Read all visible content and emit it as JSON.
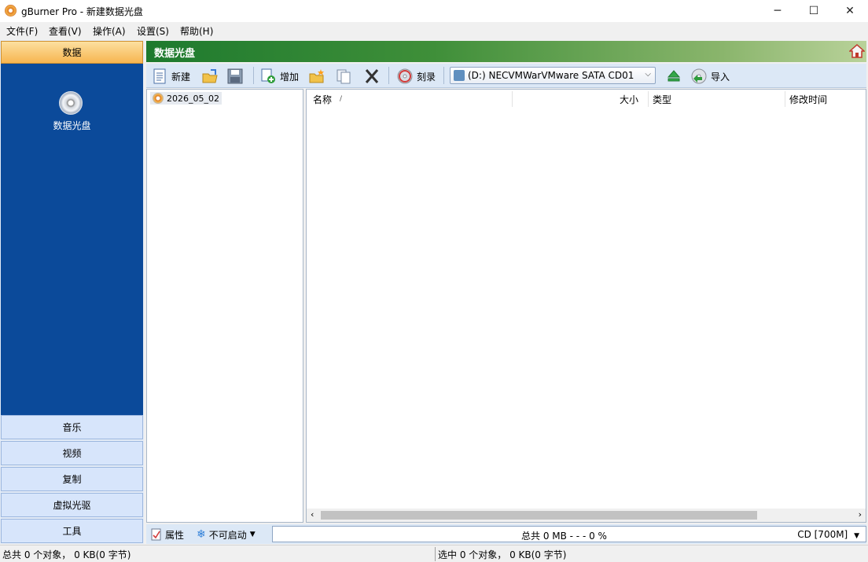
{
  "window": {
    "title": "gBurner Pro - 新建数据光盘",
    "minimize": "─",
    "maximize": "☐",
    "close": "✕"
  },
  "menu": [
    "文件(F)",
    "查看(V)",
    "操作(A)",
    "设置(S)",
    "帮助(H)"
  ],
  "sidebar": {
    "active_category": "数据",
    "active_item_label": "数据光盘",
    "categories": [
      "音乐",
      "视频",
      "复制",
      "虚拟光驱",
      "工具"
    ]
  },
  "header": {
    "title": "数据光盘"
  },
  "toolbar": {
    "new_label": "新建",
    "add_label": "增加",
    "burn_label": "刻录",
    "drive_value": "(D:) NECVMWarVMware SATA CD01",
    "import_label": "导入"
  },
  "tree": {
    "root_label": "2026_05_02"
  },
  "list": {
    "columns": {
      "name": "名称",
      "sort_indicator": "/",
      "size": "大小",
      "type": "类型",
      "modified": "修改时间"
    }
  },
  "bottom": {
    "properties_label": "属性",
    "boot_label": "不可启动",
    "total_text": "总共   0 MB    - - -   0 %",
    "media_value": "CD [700M]"
  },
  "status": {
    "left": "总共 0 个对象， 0 KB(0 字节)",
    "right": "选中 0 个对象， 0 KB(0 字节)"
  },
  "colors": {
    "sidebar_blue": "#0b4a9a",
    "header_green": "#1e7a2e",
    "active_orange": "#f7b550"
  }
}
